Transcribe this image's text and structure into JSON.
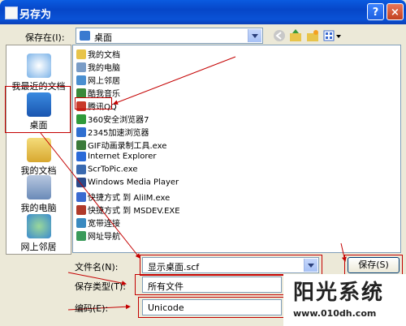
{
  "window": {
    "title": "另存为",
    "help_glyph": "?",
    "close_glyph": "×"
  },
  "save_in": {
    "label": "保存在(I):",
    "value": "桌面"
  },
  "places": [
    {
      "label": "我最近的文档",
      "icon": "recent-documents-icon"
    },
    {
      "label": "桌面",
      "icon": "desktop-icon"
    },
    {
      "label": "我的文档",
      "icon": "my-documents-icon"
    },
    {
      "label": "我的电脑",
      "icon": "my-computer-icon"
    },
    {
      "label": "网上邻居",
      "icon": "network-places-icon"
    }
  ],
  "files": [
    {
      "name": "我的文档",
      "color": "#e8c44a"
    },
    {
      "name": "我的电脑",
      "color": "#7a9cc6"
    },
    {
      "name": "网上邻居",
      "color": "#4a8fd0"
    },
    {
      "name": "酷我音乐",
      "color": "#3a8a3a"
    },
    {
      "name": "腾讯QQ",
      "color": "#c83a2a"
    },
    {
      "name": "360安全浏览器7",
      "color": "#2f9a3a"
    },
    {
      "name": "2345加速浏览器",
      "color": "#2f6fd0"
    },
    {
      "name": "GIF动画录制工具.exe",
      "color": "#3a7a3a"
    },
    {
      "name": "Internet Explorer",
      "color": "#2a6ad8"
    },
    {
      "name": "ScrToPic.exe",
      "color": "#3a6ab0"
    },
    {
      "name": "Windows Media Player",
      "color": "#2a4a8a"
    },
    {
      "name": "快捷方式 到 AliIM.exe",
      "color": "#3a6ad0"
    },
    {
      "name": "快捷方式 到 MSDEV.EXE",
      "color": "#b03a2a"
    },
    {
      "name": "宽带连接",
      "color": "#3a8ac0"
    },
    {
      "name": "网址导航",
      "color": "#3a9a5a"
    }
  ],
  "filename": {
    "label": "文件名(N):",
    "value": "显示桌面.scf"
  },
  "savetype": {
    "label": "保存类型(T):",
    "value": "所有文件"
  },
  "encoding": {
    "label": "编码(E):",
    "value": "Unicode"
  },
  "buttons": {
    "save": "保存(S)"
  },
  "watermark": {
    "title": "阳光系统",
    "url": "www.010dh.com"
  }
}
